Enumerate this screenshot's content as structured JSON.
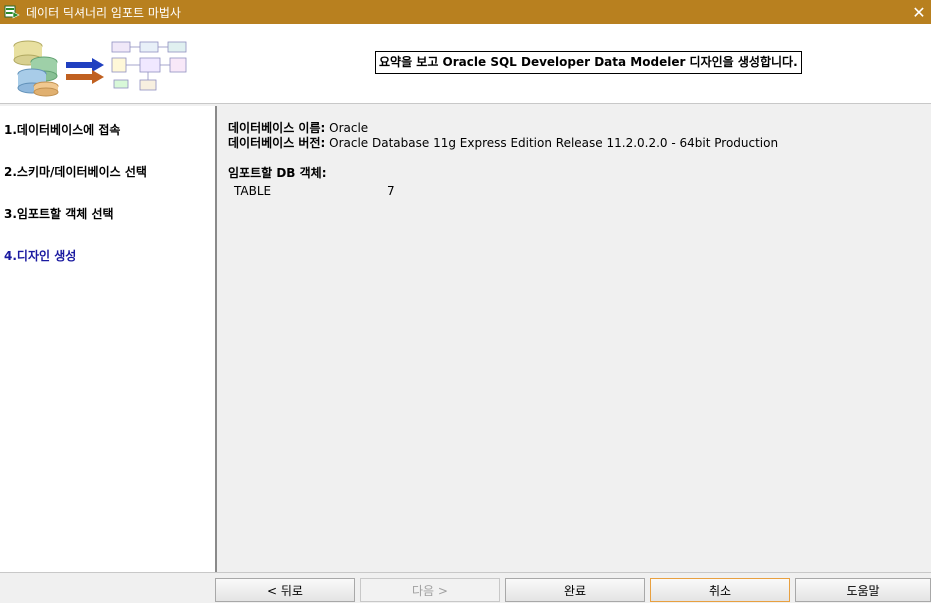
{
  "window": {
    "title": "데이터 딕셔너리 임포트 마법사",
    "close_glyph": "✕"
  },
  "banner": {
    "summary": "요약을 보고 Oracle SQL Developer Data Modeler 디자인을 생성합니다."
  },
  "steps": [
    {
      "label": "1.데이터베이스에 접속",
      "current": false
    },
    {
      "label": "2.스키마/데이터베이스 선택",
      "current": false
    },
    {
      "label": "3.임포트할 객체 선택",
      "current": false
    },
    {
      "label": "4.디자인 생성",
      "current": true
    }
  ],
  "summary": {
    "db_name_label": "데이터베이스 이름:",
    "db_name_value": "Oracle",
    "db_version_label": "데이터베이스 버전:",
    "db_version_value": "Oracle Database 11g Express Edition Release 11.2.0.2.0 - 64bit Production",
    "import_objects_label": "임포트할 DB 객체:",
    "objects": [
      {
        "type": "TABLE",
        "count": "7"
      }
    ]
  },
  "buttons": {
    "back": "< 뒤로",
    "next": "다음 >",
    "finish": "완료",
    "cancel": "취소",
    "help": "도움말"
  },
  "colors": {
    "titlebar": "#b8801f",
    "current_step": "#1a1aa0",
    "focus_border": "#e8a040"
  }
}
